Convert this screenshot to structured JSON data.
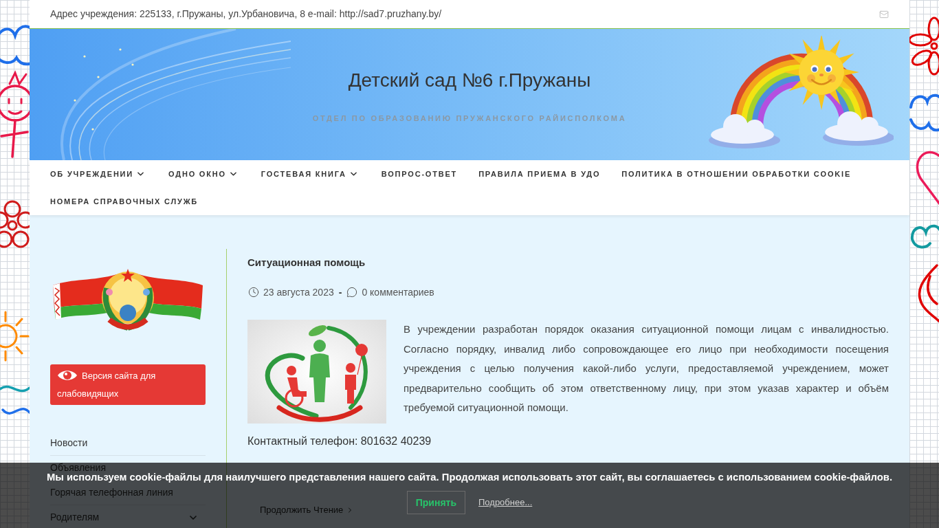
{
  "top_bar": {
    "address": "Адрес учреждения: 225133, г.Пружаны, ул.Урбановича, 8 e-mail: http://sad7.pruzhany.by/"
  },
  "header": {
    "title": "Детский сад №6 г.Пружаны",
    "subtitle": "ОТДЕЛ ПО ОБРАЗОВАНИЮ ПРУЖАНСКОГО РАЙИСПОЛКОМА"
  },
  "nav": [
    {
      "label": "ОБ УЧРЕЖДЕНИИ",
      "has_submenu": true
    },
    {
      "label": "ОДНО ОКНО",
      "has_submenu": true
    },
    {
      "label": "ГОСТЕВАЯ КНИГА",
      "has_submenu": true
    },
    {
      "label": "ВОПРОС-ОТВЕТ",
      "has_submenu": false
    },
    {
      "label": "ПРАВИЛА ПРИЕМА В УДО",
      "has_submenu": false
    },
    {
      "label": "ПОЛИТИКА В ОТНОШЕНИИ ОБРАБОТКИ COOKIE",
      "has_submenu": false
    },
    {
      "label": "НОМЕРА СПРАВОЧНЫХ СЛУЖБ",
      "has_submenu": false
    }
  ],
  "sidebar": {
    "low_vision_button": "Версия сайта для слабовидящих",
    "menu": [
      {
        "label": "Новости",
        "has_submenu": false
      },
      {
        "label": "Объявления",
        "has_submenu": false
      },
      {
        "label": "Горячая телефонная линия",
        "has_submenu": false
      },
      {
        "label": "Родителям",
        "has_submenu": true
      }
    ]
  },
  "article": {
    "title": "Ситуационная помощь",
    "date": "23 августа 2023",
    "separator": "-",
    "comments": "0 комментариев",
    "body": "В учреждении разработан порядок оказания ситуационной помощи лицам с инвалидностью. Согласно порядку, инвалид либо сопровождающее его лицо при необходимости посещения учреждения с целью получения какой-либо услуги, предоставляемой учреждением, может предварительно сообщить об этом ответственному лицу, при этом указав характер и объём требуемой ситуационной помощи.",
    "contact": "Контактный телефон: 801632 40239",
    "read_more": "Продолжить Чтение"
  },
  "cookie_bar": {
    "message": "Мы используем cookie-файлы для наилучшего представления нашего сайта. Продолжая использовать этот сайт, вы соглашаетесь с использованием cookie-файлов.",
    "accept_button": "Принять",
    "details_link": "Подробнее..."
  }
}
